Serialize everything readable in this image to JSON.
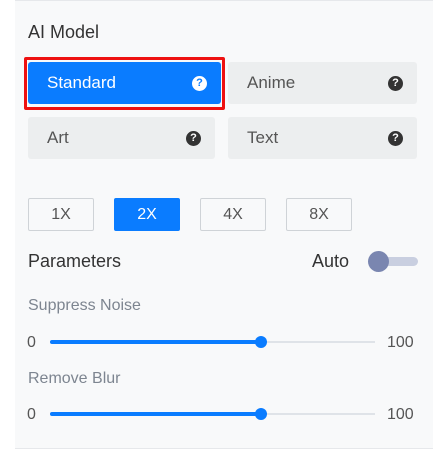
{
  "ai_model": {
    "title": "AI Model",
    "options": [
      {
        "label": "Standard",
        "help_icon": "?",
        "selected": true
      },
      {
        "label": "Anime",
        "help_icon": "?",
        "selected": false
      },
      {
        "label": "Art",
        "help_icon": "?",
        "selected": false
      },
      {
        "label": "Text",
        "help_icon": "?",
        "selected": false
      }
    ]
  },
  "scale": {
    "options": [
      "1X",
      "2X",
      "4X",
      "8X"
    ],
    "selected": "2X"
  },
  "parameters": {
    "title": "Parameters",
    "auto_label": "Auto",
    "auto_enabled": false,
    "sliders": [
      {
        "label": "Suppress Noise",
        "min": "0",
        "max": "100",
        "value": 65
      },
      {
        "label": "Remove Blur",
        "min": "0",
        "max": "100",
        "value": 65
      }
    ]
  },
  "colors": {
    "accent": "#0a7cff",
    "highlight": "#ee1111",
    "toggle_knob": "#7a86b0"
  }
}
